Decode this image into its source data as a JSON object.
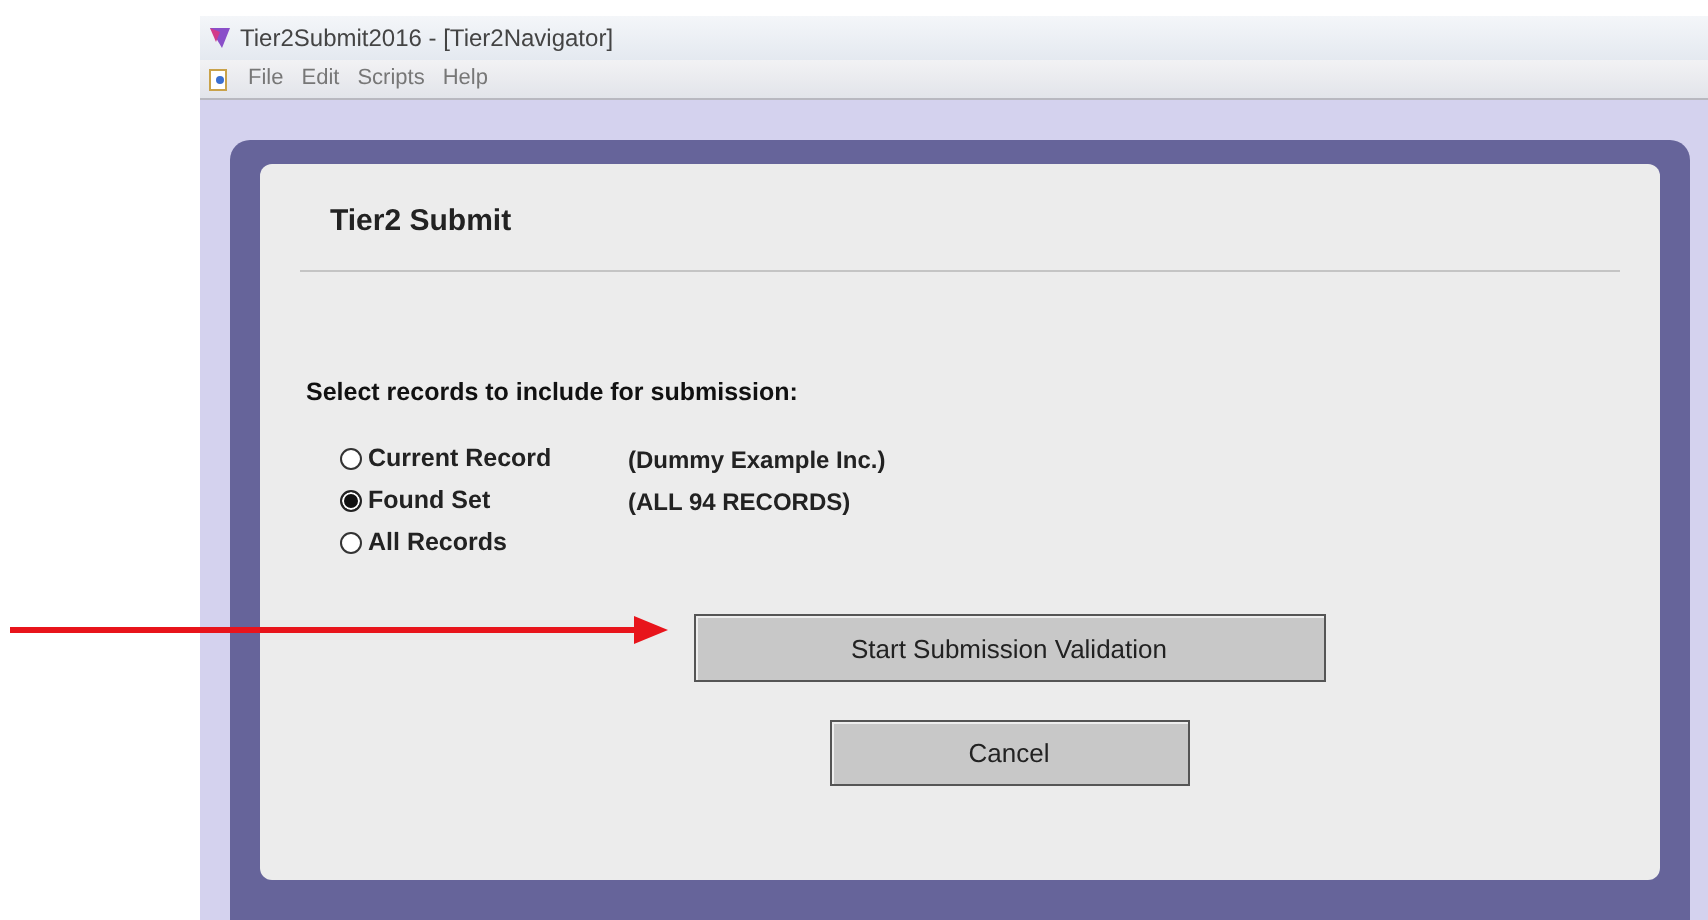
{
  "window": {
    "title": "Tier2Submit2016 - [Tier2Navigator]"
  },
  "menu": [
    "File",
    "Edit",
    "Scripts",
    "Help"
  ],
  "dialog": {
    "title": "Tier2 Submit",
    "prompt": "Select records to include for submission:",
    "options": [
      {
        "label": "Current Record",
        "note": "(Dummy Example Inc.)",
        "selected": false
      },
      {
        "label": "Found Set",
        "note": "(ALL 94 RECORDS)",
        "selected": true
      },
      {
        "label": "All Records",
        "selected": false
      }
    ],
    "buttons": [
      "Start Submission Validation",
      "Cancel"
    ]
  }
}
